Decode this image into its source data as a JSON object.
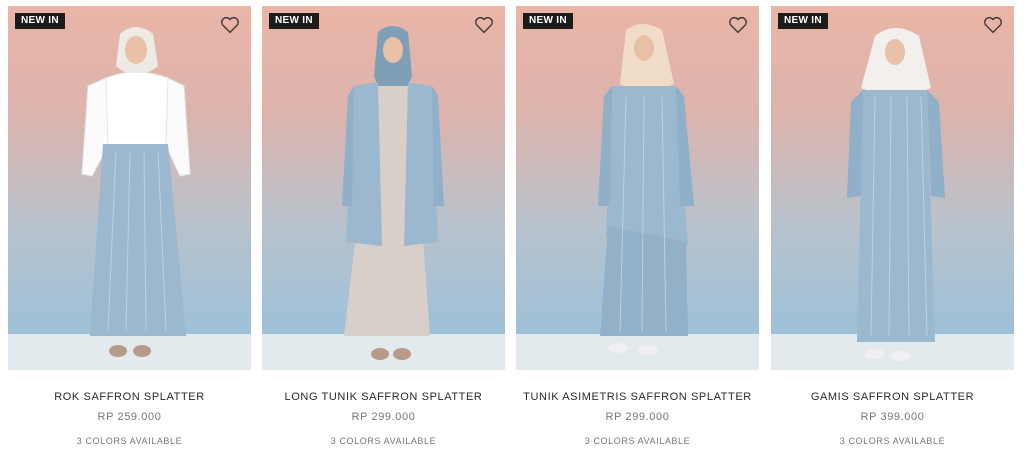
{
  "products": [
    {
      "badge": "NEW IN",
      "name": "ROK SAFFRON SPLATTER",
      "price": "RP 259.000",
      "colors": "3 COLORS AVAILABLE"
    },
    {
      "badge": "NEW IN",
      "name": "LONG TUNIK SAFFRON SPLATTER",
      "price": "RP 299.000",
      "colors": "3 COLORS AVAILABLE"
    },
    {
      "badge": "NEW IN",
      "name": "TUNIK ASIMETRIS SAFFRON SPLATTER",
      "price": "RP 299.000",
      "colors": "3 COLORS AVAILABLE"
    },
    {
      "badge": "NEW IN",
      "name": "GAMIS SAFFRON SPLATTER",
      "price": "RP 399.000",
      "colors": "3 COLORS AVAILABLE"
    }
  ],
  "icons": {
    "wishlist": "heart-outline-icon"
  },
  "colors": {
    "badge_bg": "#1c1c1c",
    "fabric_blue": "#9bb8cf",
    "backdrop_top": "#e9b5a7",
    "backdrop_bottom": "#9fc1d8"
  }
}
